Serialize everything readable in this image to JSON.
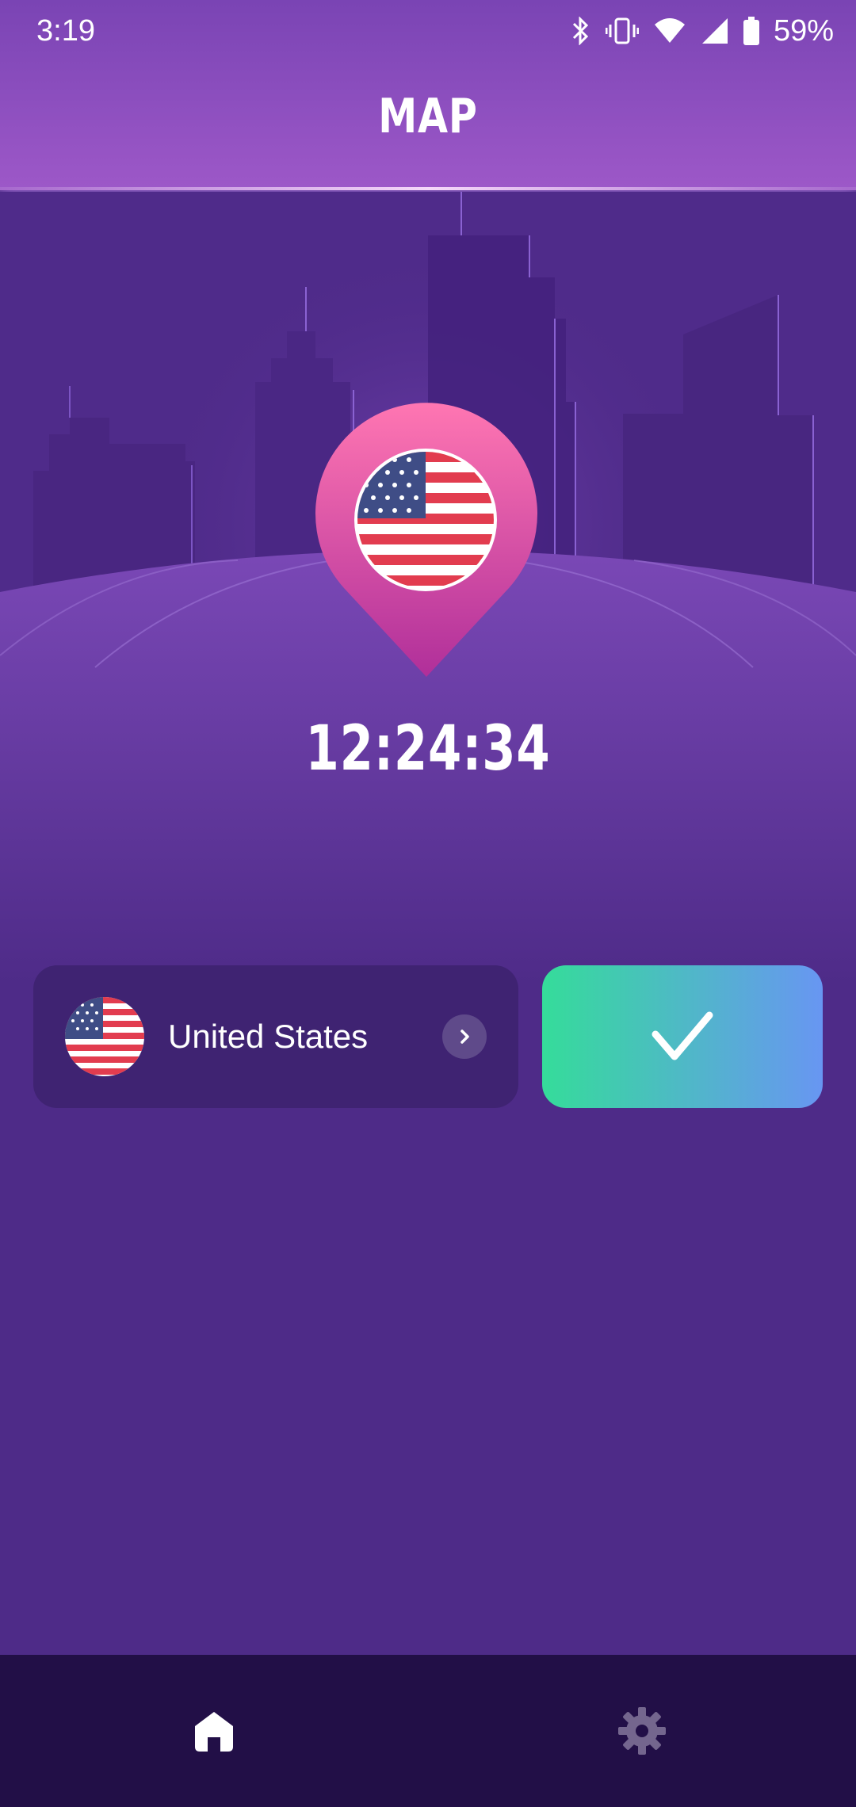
{
  "status_bar": {
    "time": "3:19",
    "battery": "59%"
  },
  "header": {
    "title": "MAP"
  },
  "connection": {
    "timer": "12:24:34"
  },
  "server": {
    "country": "United States",
    "flag_icon": "us-flag-icon"
  },
  "connect_button": {
    "icon": "check-icon",
    "colors": [
      "#35dc9a",
      "#6896f2"
    ]
  },
  "bottom_nav": {
    "items": [
      {
        "icon": "home-icon",
        "active": true
      },
      {
        "icon": "gear-icon",
        "active": false
      }
    ]
  },
  "colors": {
    "background": "#4e2b88",
    "header": "#8c4fbf",
    "pin": "#e8559f",
    "nav": "#220f47"
  }
}
